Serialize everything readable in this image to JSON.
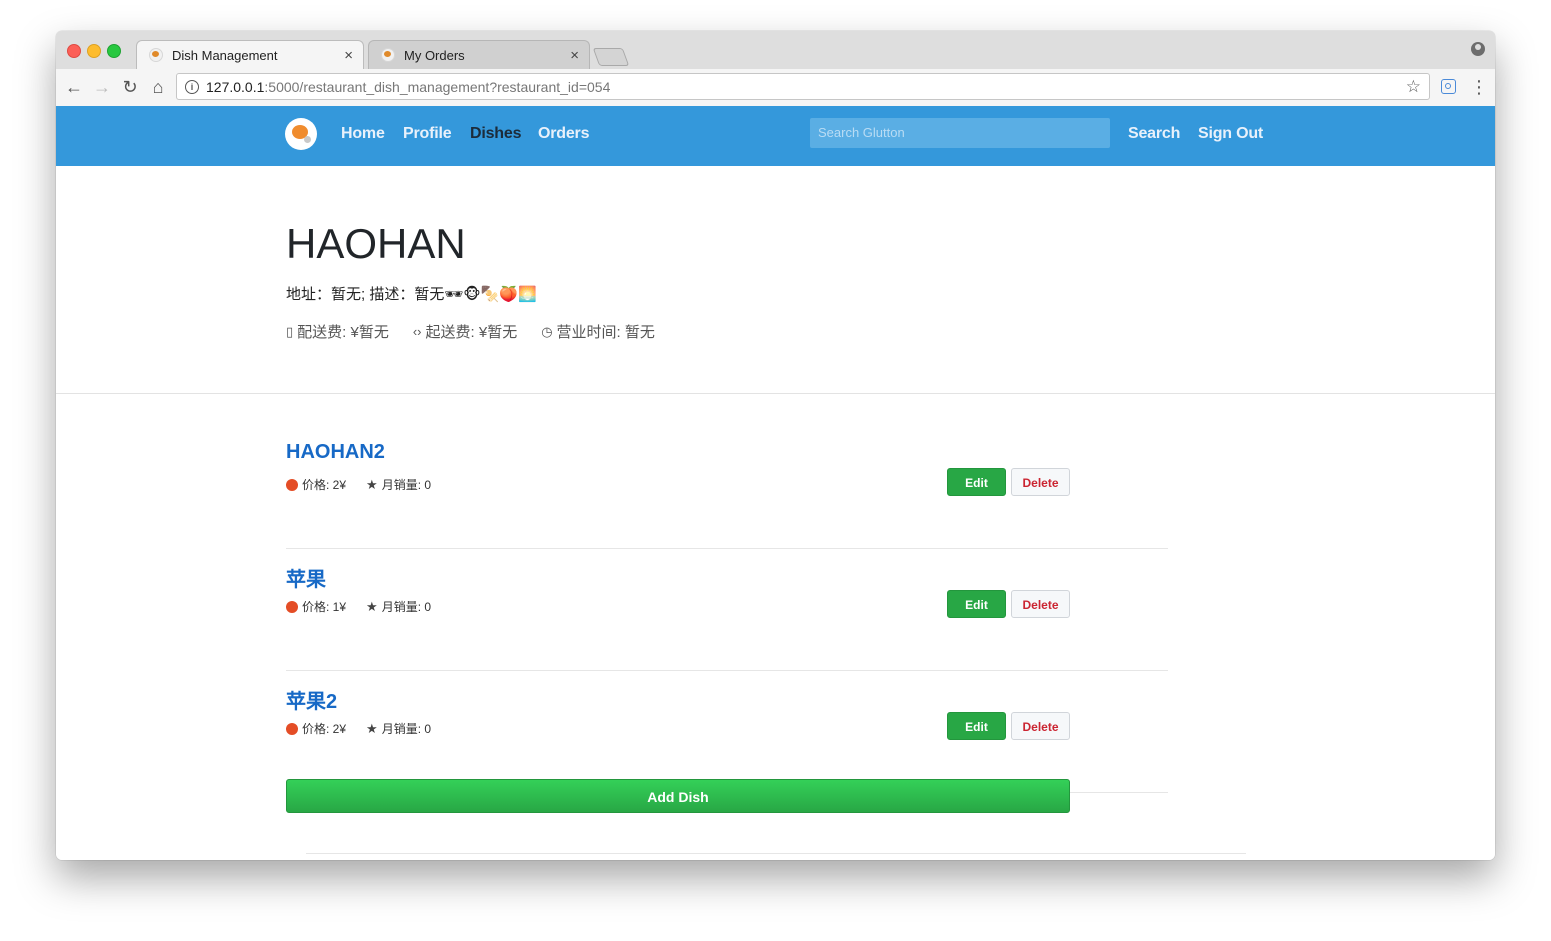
{
  "browser": {
    "tabs": [
      {
        "title": "Dish Management",
        "close": "×"
      },
      {
        "title": "My Orders",
        "close": "×"
      }
    ],
    "url_host": "127.0.0.1",
    "url_rest": ":5000/restaurant_dish_management?restaurant_id=054"
  },
  "nav": {
    "links": [
      "Home",
      "Profile",
      "Dishes",
      "Orders"
    ],
    "active": "Dishes",
    "search_placeholder": "Search Glutton",
    "search_label": "Search",
    "signout_label": "Sign Out"
  },
  "restaurant": {
    "name": "HAOHAN",
    "description": "地址：暂无; 描述：暂无🕶🐵🍢🍑🌅",
    "delivery_fee": "配送费: ¥暂无",
    "min_order": "起送费: ¥暂无",
    "hours": "营业时间: 暂无"
  },
  "dishes": [
    {
      "name": "HAOHAN2",
      "price": "价格: 2¥",
      "sales": "月销量: 0"
    },
    {
      "name": "苹果",
      "price": "价格: 1¥",
      "sales": "月销量: 0"
    },
    {
      "name": "苹果2",
      "price": "价格: 2¥",
      "sales": "月销量: 0"
    }
  ],
  "actions": {
    "edit_label": "Edit",
    "delete_label": "Delete",
    "add_dish_label": "Add Dish"
  }
}
